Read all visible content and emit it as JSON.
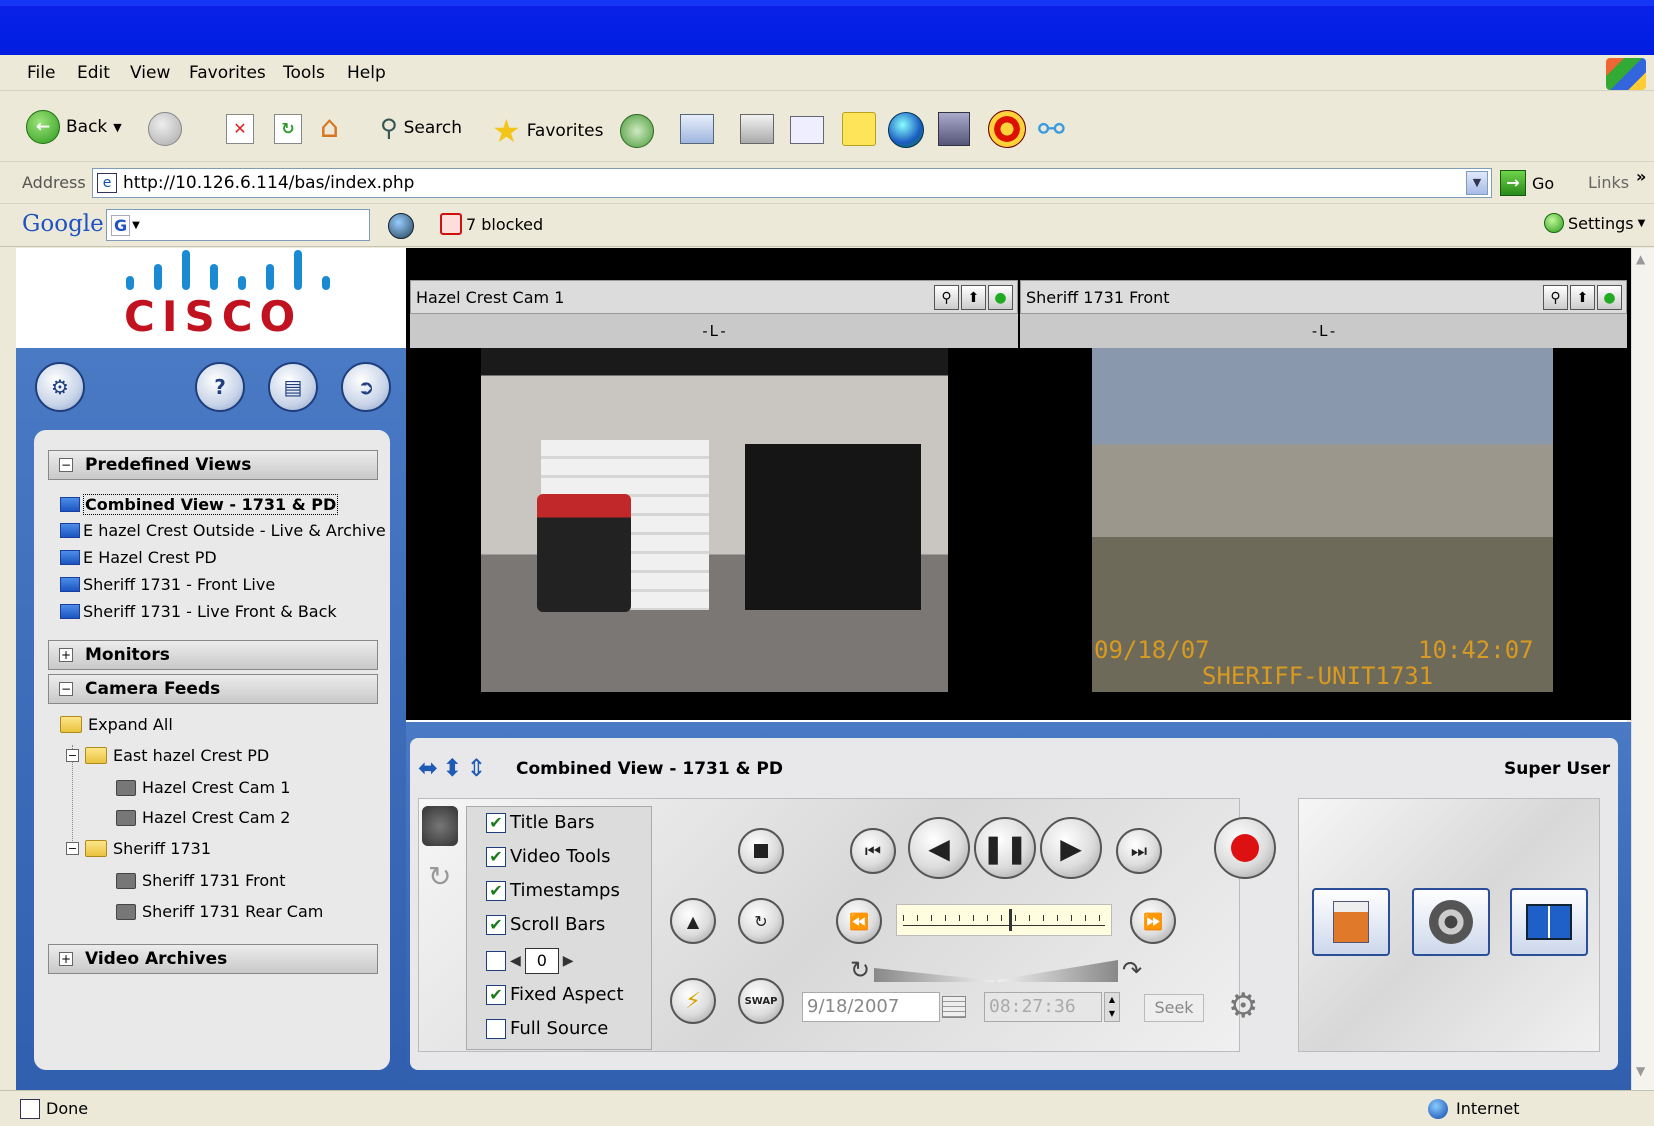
{
  "browser": {
    "menus": [
      "File",
      "Edit",
      "View",
      "Favorites",
      "Tools",
      "Help"
    ],
    "toolbar": {
      "back": "Back",
      "search": "Search",
      "favorites": "Favorites"
    },
    "address": {
      "label": "Address",
      "url": "http://10.126.6.114/bas/index.php",
      "go": "Go",
      "links": "Links"
    },
    "googlebar": {
      "logo": "Google",
      "blocked": "7 blocked",
      "settings": "Settings"
    },
    "status": {
      "left": "Done",
      "zone": "Internet"
    }
  },
  "sidebar": {
    "logo": "CISCO",
    "predefined_views": {
      "title": "Predefined Views",
      "items": [
        "Combined View - 1731 & PD",
        "E hazel Crest Outside - Live & Archive",
        "E Hazel Crest PD",
        "Sheriff 1731 - Front Live",
        "Sheriff 1731 - Live Front & Back"
      ]
    },
    "monitors": "Monitors",
    "camera_feeds": {
      "title": "Camera Feeds",
      "expand_all": "Expand All",
      "groups": [
        {
          "name": "East hazel Crest PD",
          "cams": [
            "Hazel Crest Cam 1",
            "Hazel Crest Cam 2"
          ]
        },
        {
          "name": "Sheriff 1731",
          "cams": [
            "Sheriff 1731 Front",
            "Sheriff 1731 Rear Cam"
          ]
        }
      ]
    },
    "video_archives": "Video Archives"
  },
  "video": {
    "left": {
      "title": "Hazel Crest Cam 1",
      "sub": "-L-"
    },
    "right": {
      "title": "Sheriff 1731 Front",
      "sub": "-L-",
      "overlay_date": "09/18/07",
      "overlay_time": "10:42:07",
      "overlay_unit": "SHERIFF-UNIT1731"
    }
  },
  "controls": {
    "view_title": "Combined View - 1731 & PD",
    "user": "Super User",
    "options": [
      {
        "label": "Title Bars",
        "checked": true
      },
      {
        "label": "Video Tools",
        "checked": true
      },
      {
        "label": "Timestamps",
        "checked": true
      },
      {
        "label": "Scroll Bars",
        "checked": true
      },
      {
        "label": "Fixed Aspect",
        "checked": true
      },
      {
        "label": "Full Source",
        "checked": false
      }
    ],
    "stepper_value": "0",
    "date": "9/18/2007",
    "time": "08:27:36",
    "seek": "Seek",
    "swap": "SWAP"
  }
}
